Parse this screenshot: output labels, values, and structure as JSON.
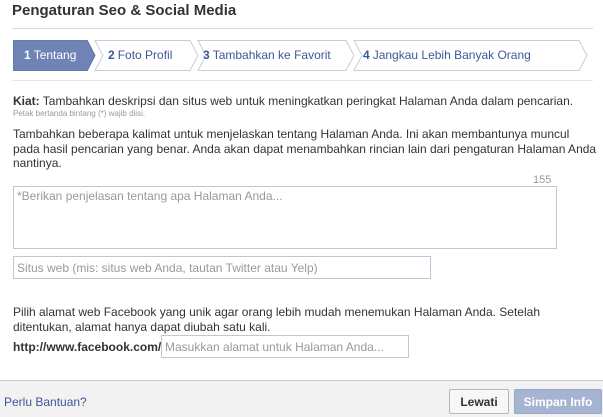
{
  "dialog": {
    "title": "Pengaturan Seo & Social Media"
  },
  "steps": [
    {
      "num": "1",
      "label": "Tentang",
      "active": true
    },
    {
      "num": "2",
      "label": "Foto Profil",
      "active": false
    },
    {
      "num": "3",
      "label": "Tambahkan ke Favorit",
      "active": false
    },
    {
      "num": "4",
      "label": "Jangkau Lebih Banyak Orang",
      "active": false
    }
  ],
  "tip": {
    "label": "Kiat:",
    "text": "Tambahkan deskripsi dan situs web untuk meningkatkan peringkat Halaman Anda dalam pencarian.",
    "required_note": "Petak bertanda bintang (*) wajib diisi."
  },
  "description": {
    "intro": "Tambahkan beberapa kalimat untuk menjelaskan tentang Halaman Anda. Ini akan membantunya muncul pada hasil pencarian yang benar. Anda akan dapat menambahkan rincian lain dari pengaturan Halaman Anda nantinya.",
    "counter": "155",
    "placeholder": "*Berikan penjelasan tentang apa Halaman Anda..."
  },
  "website": {
    "placeholder": "Situs web (mis: situs web Anda, tautan Twitter atau Yelp)"
  },
  "facebook_url": {
    "intro": "Pilih alamat web Facebook yang unik agar orang lebih mudah menemukan Halaman Anda. Setelah ditentukan, alamat hanya dapat diubah satu kali.",
    "prefix": "http://www.facebook.com/",
    "placeholder": "Masukkan alamat untuk Halaman Anda..."
  },
  "footer": {
    "help_label": "Perlu Bantuan?",
    "skip_label": "Lewati",
    "save_label": "Simpan Info"
  },
  "colors": {
    "active_step": "#6d84b4",
    "link": "#3b5998",
    "save_disabled": "#a5b4d1"
  }
}
